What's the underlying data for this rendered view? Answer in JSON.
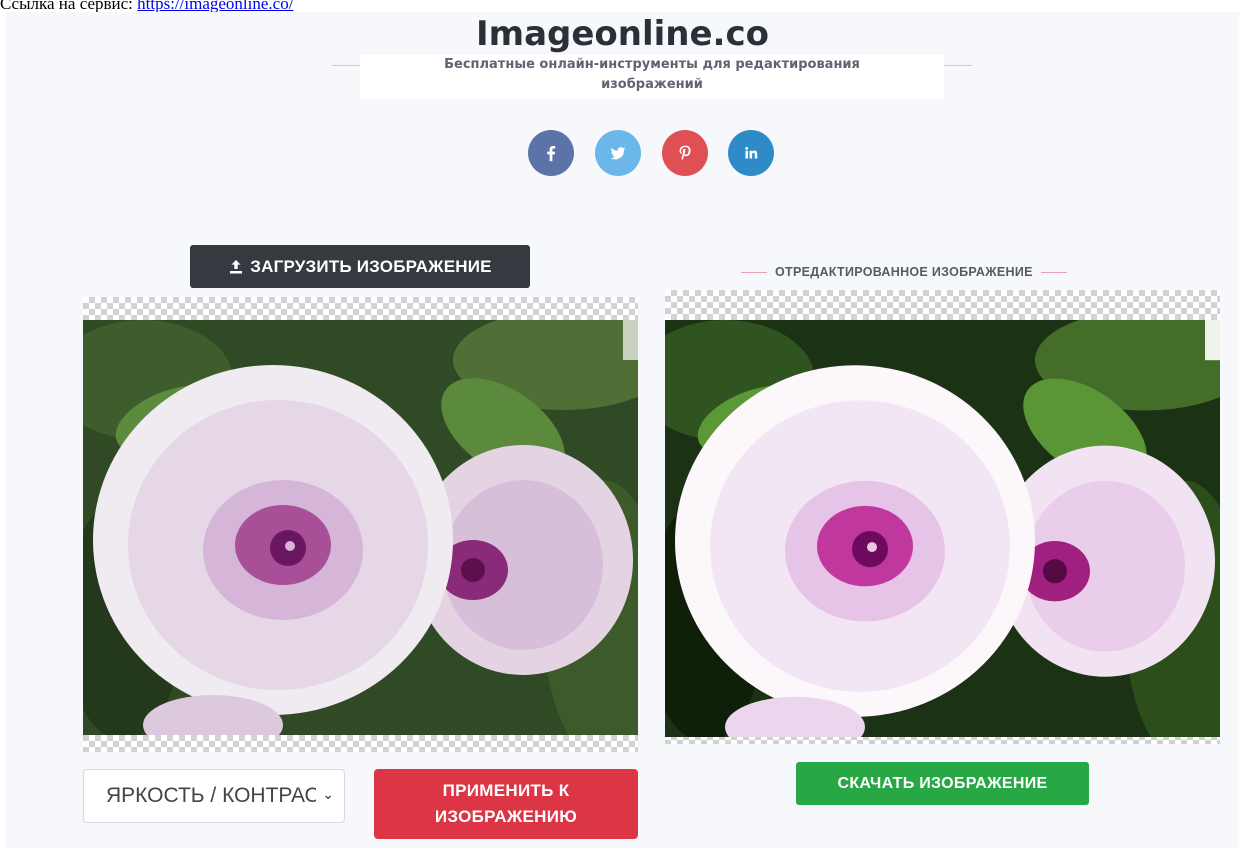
{
  "doc": {
    "prefix": "Ссылка на сервис: ",
    "link": "https://imageonline.co/"
  },
  "header": {
    "logo": "Imageonline.co",
    "tagline_1": "Бесплатные онлайн-инструменты для редактирования",
    "tagline_2": "изображений"
  },
  "social": [
    {
      "name": "facebook-icon",
      "color": "#5b73a8"
    },
    {
      "name": "twitter-icon",
      "color": "#6cb7ea"
    },
    {
      "name": "pinterest-icon",
      "color": "#e04f54"
    },
    {
      "name": "linkedin-icon",
      "color": "#2f8bc7"
    }
  ],
  "upload": {
    "label": "ЗАГРУЗИТЬ ИЗОБРАЖЕНИЕ",
    "icon": "upload-icon"
  },
  "edited": {
    "label": "ОТРЕДАКТИРОВАННОЕ ИЗОБРАЖЕНИЕ"
  },
  "controls": {
    "select_value": "ЯРКОСТЬ / КОНТРАСТНОСТЬ",
    "apply_line_1": "ПРИМЕНИТЬ К",
    "apply_line_2": "ИЗОБРАЖЕНИЮ",
    "download_label": "СКАЧАТЬ ИЗОБРАЖЕНИЕ"
  },
  "colors": {
    "upload_button": "#343a40",
    "apply_button": "#dc3545",
    "download_button": "#28a745"
  }
}
